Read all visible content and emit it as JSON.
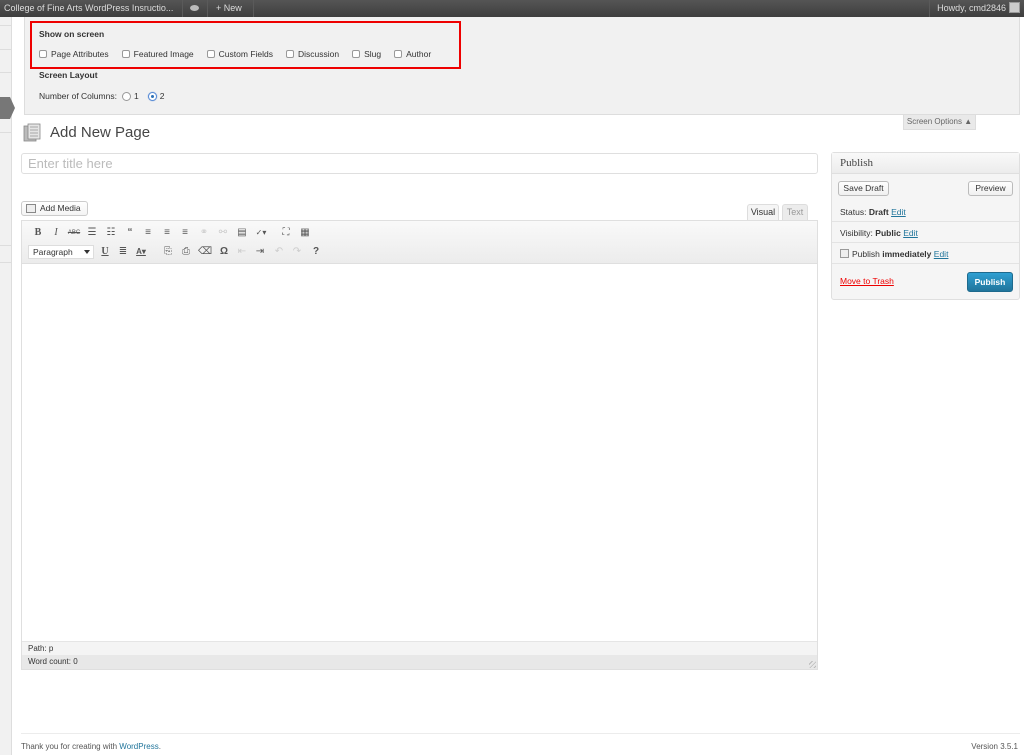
{
  "adminbar": {
    "site_name": "College of Fine Arts WordPress Insructio...",
    "comments_icon": "comment-bubble-icon",
    "new_label": "+ New",
    "greeting": "Howdy, cmd2846",
    "avatar_icon": "user-avatar-icon"
  },
  "screen_options": {
    "show_heading": "Show on screen",
    "checkboxes": [
      {
        "label": "Page Attributes",
        "checked": false
      },
      {
        "label": "Featured Image",
        "checked": false
      },
      {
        "label": "Custom Fields",
        "checked": false
      },
      {
        "label": "Discussion",
        "checked": false
      },
      {
        "label": "Slug",
        "checked": false
      },
      {
        "label": "Author",
        "checked": false
      }
    ],
    "layout_heading": "Screen Layout",
    "columns_label": "Number of Columns:",
    "column_options": [
      "1",
      "2"
    ],
    "selected_columns": "2",
    "tab_label": "Screen Options ▲",
    "highlight_color": "#ee0000"
  },
  "page": {
    "title": "Add New Page",
    "title_placeholder": "Enter title here",
    "add_media_label": "Add Media"
  },
  "editor": {
    "tabs": [
      "Visual",
      "Text"
    ],
    "active_tab": "Visual",
    "format_select": "Paragraph",
    "toolbar_row1": [
      "bold",
      "italic",
      "strikethrough",
      "bullet-list",
      "numbered-list",
      "blockquote",
      "align-left",
      "align-center",
      "align-right",
      "insert-link",
      "unlink",
      "insert-more",
      "spellcheck",
      "fullscreen",
      "kitchen-sink"
    ],
    "toolbar_row2": [
      "underline",
      "justify",
      "text-color",
      "paste-text",
      "paste-word",
      "clear-formatting",
      "special-character",
      "outdent",
      "indent",
      "undo",
      "redo",
      "help"
    ],
    "path": "Path: p",
    "word_count": "Word count: 0"
  },
  "publish": {
    "heading": "Publish",
    "save_draft": "Save Draft",
    "preview": "Preview",
    "status_label": "Status:",
    "status_value": "Draft",
    "visibility_label": "Visibility:",
    "visibility_value": "Public",
    "publish_label": "Publish",
    "publish_when": "immediately",
    "edit_link": "Edit",
    "move_to_trash": "Move to Trash",
    "publish_button": "Publish",
    "accent_color": "#21759b"
  },
  "footer": {
    "thanks_prefix": "Thank you for creating with ",
    "wordpress_link": "WordPress",
    "thanks_suffix": ".",
    "version": "Version 3.5.1"
  }
}
